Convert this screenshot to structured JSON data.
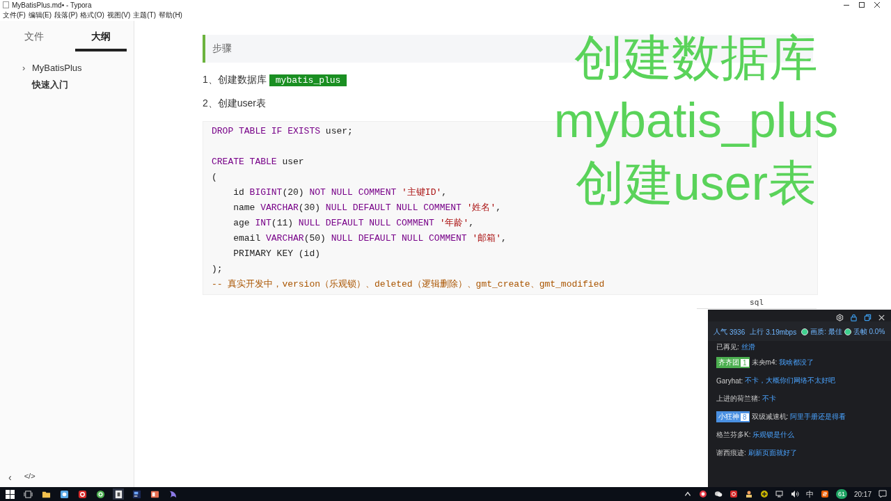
{
  "window": {
    "title": "MyBatisPlus.md• - Typora"
  },
  "menu": [
    "文件(F)",
    "编辑(E)",
    "段落(P)",
    "格式(O)",
    "视图(V)",
    "主题(T)",
    "帮助(H)"
  ],
  "sidebar": {
    "tabs": [
      {
        "label": "文件",
        "selected": false
      },
      {
        "label": "大纲",
        "selected": true
      }
    ],
    "outline": [
      {
        "label": "MyBatisPlus",
        "toggle": "›",
        "expanded": false
      },
      {
        "label": "快速入门",
        "selected": true
      }
    ],
    "footer": [
      "‹",
      "</>"
    ]
  },
  "document": {
    "note": "步骤",
    "steps": [
      {
        "text": "1、创建数据库",
        "code": "mybatis_plus"
      },
      {
        "text": "2、创建user表"
      }
    ],
    "code_block": {
      "language": "sql",
      "lines": [
        {
          "tokens": [
            {
              "kind": "keyword",
              "t": "DROP TABLE IF EXISTS"
            },
            {
              "kind": "plain",
              "t": " user;"
            }
          ]
        },
        {
          "blank_before": true,
          "tokens": [
            {
              "kind": "keyword",
              "t": "CREATE TABLE"
            },
            {
              "kind": "plain",
              "t": " user"
            }
          ]
        },
        {
          "tokens": [
            {
              "kind": "plain",
              "t": "("
            }
          ]
        },
        {
          "tokens": [
            {
              "kind": "plain",
              "t": "    id "
            },
            {
              "kind": "keyword",
              "t": "BIGINT"
            },
            {
              "kind": "plain",
              "t": "(20) "
            },
            {
              "kind": "keyword",
              "t": "NOT NULL COMMENT "
            },
            {
              "kind": "string",
              "t": "'主键ID'"
            },
            {
              "kind": "plain",
              "t": ","
            }
          ]
        },
        {
          "tokens": [
            {
              "kind": "plain",
              "t": "    name "
            },
            {
              "kind": "keyword",
              "t": "VARCHAR"
            },
            {
              "kind": "plain",
              "t": "(30) "
            },
            {
              "kind": "keyword",
              "t": "NULL DEFAULT NULL COMMENT "
            },
            {
              "kind": "string",
              "t": "'姓名'"
            },
            {
              "kind": "plain",
              "t": ","
            }
          ]
        },
        {
          "tokens": [
            {
              "kind": "plain",
              "t": "    age "
            },
            {
              "kind": "keyword",
              "t": "INT"
            },
            {
              "kind": "plain",
              "t": "(11) "
            },
            {
              "kind": "keyword",
              "t": "NULL DEFAULT NULL COMMENT "
            },
            {
              "kind": "string",
              "t": "'年龄'"
            },
            {
              "kind": "plain",
              "t": ","
            }
          ]
        },
        {
          "tokens": [
            {
              "kind": "plain",
              "t": "    email "
            },
            {
              "kind": "keyword",
              "t": "VARCHAR"
            },
            {
              "kind": "plain",
              "t": "(50) "
            },
            {
              "kind": "keyword",
              "t": "NULL DEFAULT NULL COMMENT "
            },
            {
              "kind": "string",
              "t": "'邮箱'"
            },
            {
              "kind": "plain",
              "t": ","
            }
          ]
        },
        {
          "tokens": [
            {
              "kind": "plain",
              "t": "    PRIMARY KEY (id)"
            }
          ]
        },
        {
          "tokens": [
            {
              "kind": "plain",
              "t": ");"
            }
          ]
        },
        {
          "tokens": [
            {
              "kind": "comment",
              "t": "-- 真实开发中，version（乐观锁）、deleted（逻辑删除）、gmt_create、gmt_modified"
            }
          ]
        }
      ]
    }
  },
  "overlay_caption": [
    "创建数据库",
    "mybatis_plus",
    "创建user表"
  ],
  "chat": {
    "stats": [
      {
        "label": "人气",
        "value": "3936"
      },
      {
        "label": "上行",
        "value": "3.19mbps"
      }
    ],
    "indicators": [
      {
        "label": "画质: 最佳",
        "color": "#3ecf8e"
      },
      {
        "label": "丢帧 0.0%",
        "color": "#3ecf8e"
      }
    ],
    "messages": [
      {
        "user": "已再见:",
        "text": "丝滑"
      },
      {
        "badge": {
          "name": "齐齐团",
          "level": "1",
          "color": "#4caf50"
        },
        "user": "未央m4:",
        "text": "我啥都没了"
      },
      {
        "user": "Garyhat:",
        "text": "不卡，大概你们网络不太好吧"
      },
      {
        "user": "上进的荷兰猪:",
        "text": "不卡"
      },
      {
        "badge": {
          "name": "小狂神",
          "level": "8",
          "color": "#4a90e2"
        },
        "user": "双级减速机:",
        "text": "阿里手册还是得看"
      },
      {
        "user": "格兰芬多K:",
        "text": "乐观锁是什么"
      },
      {
        "user": "谢西痕迹:",
        "text": "刷新页面就好了"
      }
    ]
  },
  "taskbar": {
    "ime": "中",
    "clock": "20:17",
    "badge": "61"
  }
}
